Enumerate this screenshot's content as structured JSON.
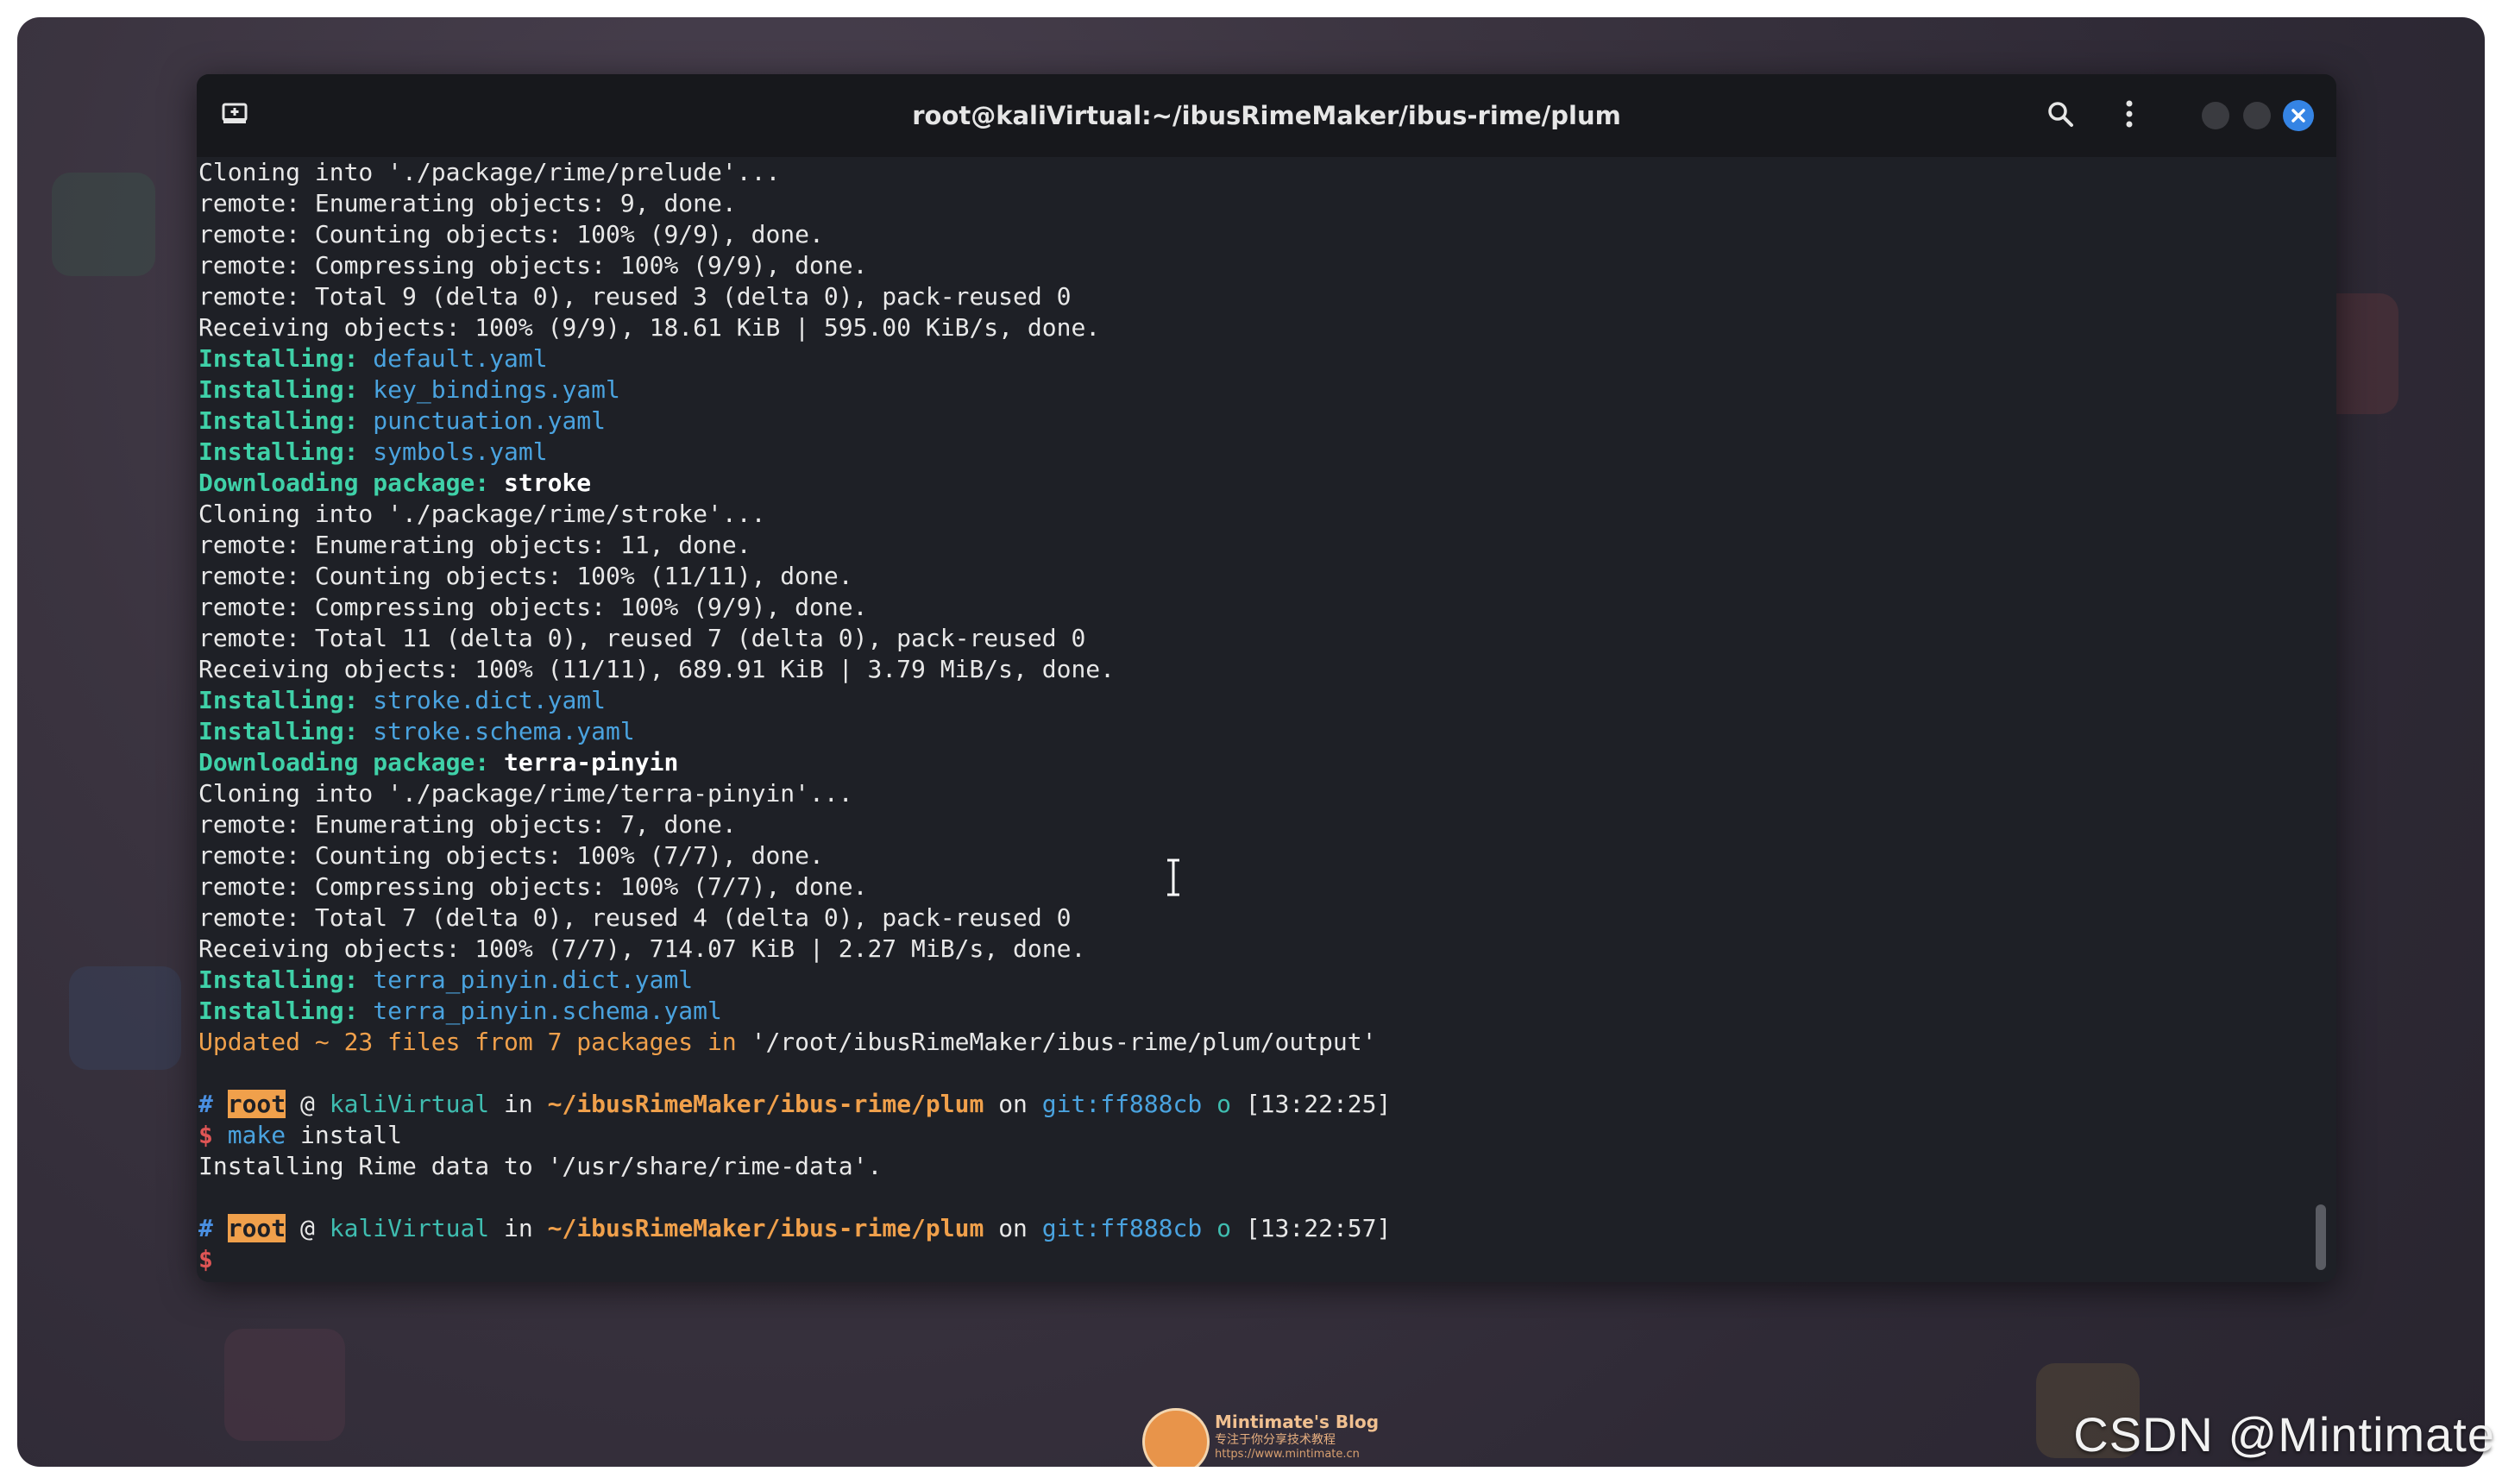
{
  "window": {
    "title": "root@kaliVirtual:~/ibusRimeMaker/ibus-rime/plum"
  },
  "terminal": {
    "lines": [
      [
        {
          "t": "Cloning into './package/rime/prelude'...",
          "c": ""
        }
      ],
      [
        {
          "t": "remote: Enumerating objects: 9, done.",
          "c": ""
        }
      ],
      [
        {
          "t": "remote: Counting objects: 100% (9/9), done.",
          "c": ""
        }
      ],
      [
        {
          "t": "remote: Compressing objects: 100% (9/9), done.",
          "c": ""
        }
      ],
      [
        {
          "t": "remote: Total 9 (delta 0), reused 3 (delta 0), pack-reused 0",
          "c": ""
        }
      ],
      [
        {
          "t": "Receiving objects: 100% (9/9), 18.61 KiB | 595.00 KiB/s, done.",
          "c": ""
        }
      ],
      [
        {
          "t": "Installing:",
          "c": "c-green"
        },
        {
          "t": " default.yaml",
          "c": "c-blue"
        }
      ],
      [
        {
          "t": "Installing:",
          "c": "c-green"
        },
        {
          "t": " key_bindings.yaml",
          "c": "c-blue"
        }
      ],
      [
        {
          "t": "Installing:",
          "c": "c-green"
        },
        {
          "t": " punctuation.yaml",
          "c": "c-blue"
        }
      ],
      [
        {
          "t": "Installing:",
          "c": "c-green"
        },
        {
          "t": " symbols.yaml",
          "c": "c-blue"
        }
      ],
      [
        {
          "t": "Downloading package:",
          "c": "c-green"
        },
        {
          "t": " stroke",
          "c": "c-white-b"
        }
      ],
      [
        {
          "t": "Cloning into './package/rime/stroke'...",
          "c": ""
        }
      ],
      [
        {
          "t": "remote: Enumerating objects: 11, done.",
          "c": ""
        }
      ],
      [
        {
          "t": "remote: Counting objects: 100% (11/11), done.",
          "c": ""
        }
      ],
      [
        {
          "t": "remote: Compressing objects: 100% (9/9), done.",
          "c": ""
        }
      ],
      [
        {
          "t": "remote: Total 11 (delta 0), reused 7 (delta 0), pack-reused 0",
          "c": ""
        }
      ],
      [
        {
          "t": "Receiving objects: 100% (11/11), 689.91 KiB | 3.79 MiB/s, done.",
          "c": ""
        }
      ],
      [
        {
          "t": "Installing:",
          "c": "c-green"
        },
        {
          "t": " stroke.dict.yaml",
          "c": "c-blue"
        }
      ],
      [
        {
          "t": "Installing:",
          "c": "c-green"
        },
        {
          "t": " stroke.schema.yaml",
          "c": "c-blue"
        }
      ],
      [
        {
          "t": "Downloading package:",
          "c": "c-green"
        },
        {
          "t": " terra-pinyin",
          "c": "c-white-b"
        }
      ],
      [
        {
          "t": "Cloning into './package/rime/terra-pinyin'...",
          "c": ""
        }
      ],
      [
        {
          "t": "remote: Enumerating objects: 7, done.",
          "c": ""
        }
      ],
      [
        {
          "t": "remote: Counting objects: 100% (7/7), done.",
          "c": ""
        }
      ],
      [
        {
          "t": "remote: Compressing objects: 100% (7/7), done.",
          "c": ""
        }
      ],
      [
        {
          "t": "remote: Total 7 (delta 0), reused 4 (delta 0), pack-reused 0",
          "c": ""
        }
      ],
      [
        {
          "t": "Receiving objects: 100% (7/7), 714.07 KiB | 2.27 MiB/s, done.",
          "c": ""
        }
      ],
      [
        {
          "t": "Installing:",
          "c": "c-green"
        },
        {
          "t": " terra_pinyin.dict.yaml",
          "c": "c-blue"
        }
      ],
      [
        {
          "t": "Installing:",
          "c": "c-green"
        },
        {
          "t": " terra_pinyin.schema.yaml",
          "c": "c-blue"
        }
      ],
      [
        {
          "t": "Updated ~ 23 files from 7 packages in ",
          "c": "c-orange"
        },
        {
          "t": "'/root/ibusRimeMaker/ibus-rime/plum/output'",
          "c": ""
        }
      ],
      [
        {
          "t": " ",
          "c": ""
        }
      ],
      [
        {
          "t": "#",
          "c": "c-hash"
        },
        {
          "t": " ",
          "c": ""
        },
        {
          "t": "root",
          "c": "c-root"
        },
        {
          "t": " @ ",
          "c": ""
        },
        {
          "t": "kaliVirtual",
          "c": "c-teal"
        },
        {
          "t": " in ",
          "c": ""
        },
        {
          "t": "~/ibusRimeMaker/ibus-rime/plum",
          "c": "c-orange-b"
        },
        {
          "t": " on ",
          "c": ""
        },
        {
          "t": "git:ff888cb",
          "c": "c-gitblue"
        },
        {
          "t": " o",
          "c": "c-teal"
        },
        {
          "t": " [13:22:25]",
          "c": ""
        }
      ],
      [
        {
          "t": "$",
          "c": "c-red"
        },
        {
          "t": " make",
          "c": "c-cmd"
        },
        {
          "t": " install",
          "c": ""
        }
      ],
      [
        {
          "t": "Installing Rime data to '/usr/share/rime-data'.",
          "c": ""
        }
      ],
      [
        {
          "t": " ",
          "c": ""
        }
      ],
      [
        {
          "t": "#",
          "c": "c-hash"
        },
        {
          "t": " ",
          "c": ""
        },
        {
          "t": "root",
          "c": "c-root"
        },
        {
          "t": " @ ",
          "c": ""
        },
        {
          "t": "kaliVirtual",
          "c": "c-teal"
        },
        {
          "t": " in ",
          "c": ""
        },
        {
          "t": "~/ibusRimeMaker/ibus-rime/plum",
          "c": "c-orange-b"
        },
        {
          "t": " on ",
          "c": ""
        },
        {
          "t": "git:ff888cb",
          "c": "c-gitblue"
        },
        {
          "t": " o",
          "c": "c-teal"
        },
        {
          "t": " [13:22:57]",
          "c": ""
        }
      ],
      [
        {
          "t": "$",
          "c": "c-red"
        }
      ]
    ]
  },
  "icons": {
    "new_tab": "new-tab-icon",
    "search": "search-icon",
    "menu": "kebab-menu-icon",
    "close": "close-icon"
  },
  "colors": {
    "accent": "#3584e4",
    "terminal_bg": "#1e2026",
    "installing": "#3fd1a8",
    "filename": "#4aa3df",
    "path": "#f0a04b"
  },
  "watermark": {
    "blog_name": "Mintimate's Blog",
    "blog_tagline": "专注于你分享技术教程",
    "blog_url": "https://www.mintimate.cn",
    "csdn": "CSDN @Mintimate"
  }
}
